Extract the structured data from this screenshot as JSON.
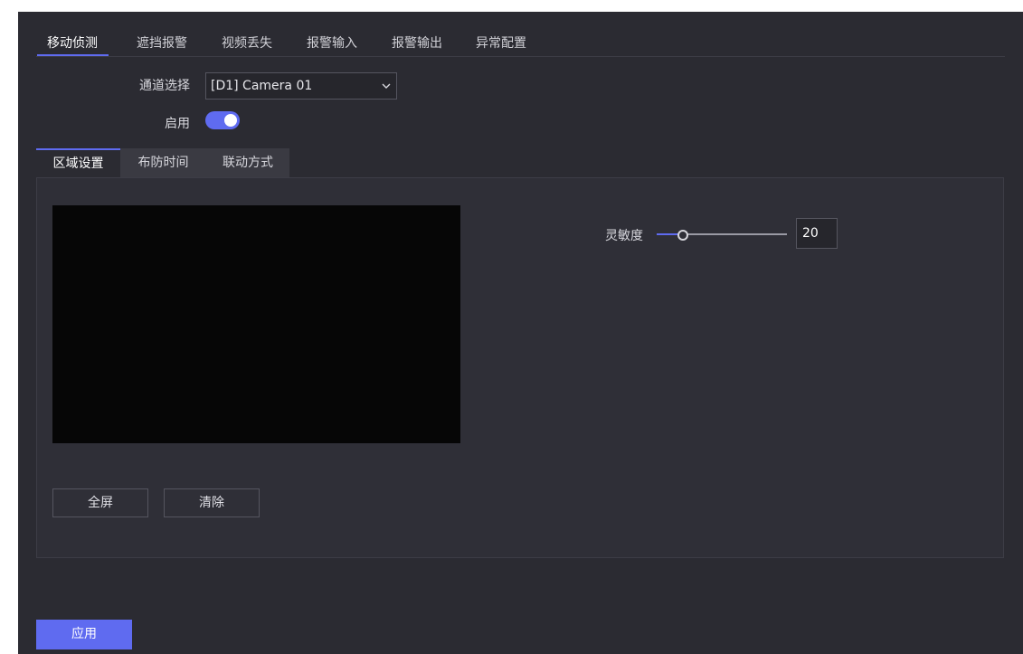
{
  "top_tabs": {
    "motion": "移动侦测",
    "tamper": "遮挡报警",
    "video_loss": "视频丢失",
    "alarm_input": "报警输入",
    "alarm_output": "报警输出",
    "exception": "异常配置"
  },
  "channel": {
    "label": "通道选择",
    "value": "[D1] Camera 01"
  },
  "enable": {
    "label": "启用",
    "on": true
  },
  "sub_tabs": {
    "area": "区域设置",
    "schedule": "布防时间",
    "linkage": "联动方式"
  },
  "buttons": {
    "fullscreen": "全屏",
    "clear": "清除",
    "apply": "应用"
  },
  "sensitivity": {
    "label": "灵敏度",
    "value": "20",
    "percent": 20
  },
  "colors": {
    "accent": "#5f6bf0",
    "background": "#2b2b32",
    "video": "#060606"
  }
}
